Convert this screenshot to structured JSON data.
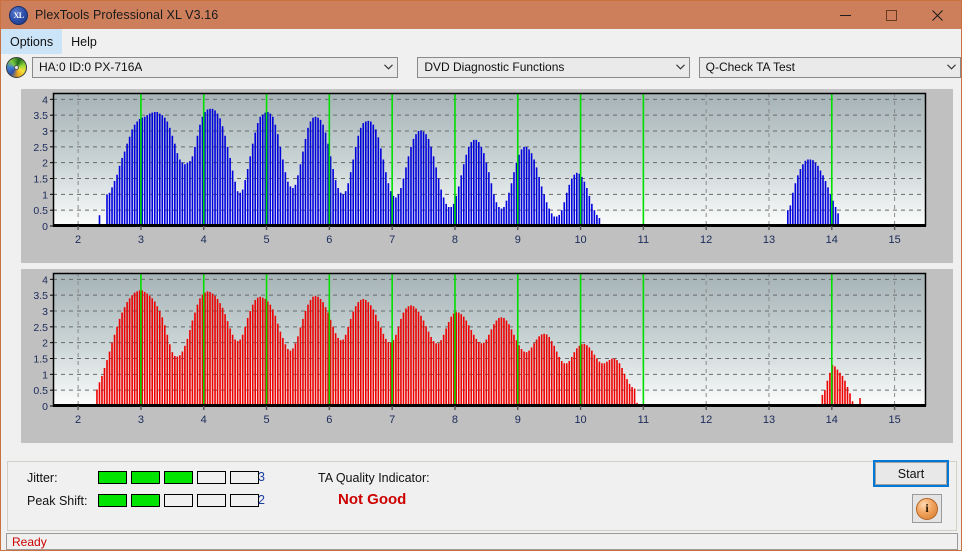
{
  "window": {
    "title": "PlexTools Professional XL V3.16",
    "icon": "app-xl-icon",
    "icon_text": "XL",
    "titlebar_color": "#cd7f5c",
    "controls": {
      "minimize": "minimize-icon",
      "maximize": "maximize-icon",
      "close": "close-icon"
    }
  },
  "menu": {
    "items": [
      {
        "label": "Options",
        "selected": true
      },
      {
        "label": "Help",
        "selected": false
      }
    ]
  },
  "toolbar": {
    "drive_icon": "disc-icon",
    "drive": {
      "value": "HA:0 ID:0  PX-716A",
      "arrow": "chevron-down-icon"
    },
    "category": {
      "value": "DVD Diagnostic Functions",
      "arrow": "chevron-down-icon"
    },
    "test": {
      "value": "Q-Check TA Test",
      "arrow": "chevron-down-icon"
    }
  },
  "results": {
    "jitter_label": "Jitter:",
    "jitter_value": "3",
    "jitter_filled": 3,
    "jitter_total": 5,
    "peakshift_label": "Peak Shift:",
    "peakshift_value": "2",
    "peakshift_filled": 2,
    "peakshift_total": 5,
    "ta_quality_label": "TA Quality Indicator:",
    "ta_quality_value": "Not Good",
    "ta_quality_color": "#cc0000",
    "meter_on_color": "#00e400",
    "start_label": "Start",
    "info_icon": "info-icon",
    "info_glyph": "i"
  },
  "statusbar": {
    "text": "Ready",
    "color": "#cc0000"
  },
  "chart_data": [
    {
      "id": "top-chart",
      "type": "bar",
      "series_name": "Jitter",
      "bar_color": "#0000dd",
      "title": "",
      "xlabel": "",
      "ylabel": "",
      "xlim": [
        1.6,
        15.5
      ],
      "ylim": [
        0,
        4.2
      ],
      "yticks": [
        0,
        0.5,
        1,
        1.5,
        2,
        2.5,
        3,
        3.5,
        4
      ],
      "ytick_labels": [
        "0",
        "0.5",
        "1",
        "1.5",
        "2",
        "2.5",
        "3",
        "3.5",
        "4"
      ],
      "xticks": [
        2,
        3,
        4,
        5,
        6,
        7,
        8,
        9,
        10,
        11,
        12,
        13,
        14,
        15
      ],
      "xtick_labels": [
        "2",
        "3",
        "4",
        "5",
        "6",
        "7",
        "8",
        "9",
        "10",
        "11",
        "12",
        "13",
        "14",
        "15"
      ],
      "grid": true,
      "marker_lines": [
        3,
        4,
        5,
        6,
        7,
        8,
        9,
        10,
        11,
        14
      ],
      "marker_color": "#00e000",
      "bar_step": 0.04,
      "x_start": 2.34,
      "values": [
        0.34,
        0.05,
        0.06,
        1.0,
        1.05,
        1.22,
        1.42,
        1.62,
        1.9,
        2.15,
        2.35,
        2.6,
        2.82,
        3.05,
        3.2,
        3.3,
        3.38,
        3.42,
        3.45,
        3.5,
        3.55,
        3.58,
        3.6,
        3.6,
        3.55,
        3.5,
        3.42,
        3.3,
        3.1,
        2.85,
        2.6,
        2.3,
        2.1,
        2.0,
        1.95,
        2.0,
        2.05,
        2.2,
        2.5,
        2.85,
        3.2,
        3.45,
        3.6,
        3.68,
        3.7,
        3.7,
        3.65,
        3.55,
        3.4,
        3.15,
        2.85,
        2.5,
        2.15,
        1.75,
        1.4,
        1.1,
        1.05,
        1.15,
        1.45,
        1.8,
        2.2,
        2.6,
        2.95,
        3.25,
        3.45,
        3.52,
        3.58,
        3.6,
        3.55,
        3.45,
        3.2,
        2.9,
        2.5,
        2.1,
        1.7,
        1.4,
        1.25,
        1.2,
        1.3,
        1.6,
        1.95,
        2.35,
        2.75,
        3.1,
        3.3,
        3.42,
        3.45,
        3.42,
        3.35,
        3.2,
        2.95,
        2.6,
        2.2,
        1.8,
        1.45,
        1.2,
        1.05,
        1.0,
        1.1,
        1.35,
        1.7,
        2.1,
        2.5,
        2.85,
        3.1,
        3.25,
        3.3,
        3.32,
        3.3,
        3.2,
        3.05,
        2.8,
        2.45,
        2.1,
        1.7,
        1.35,
        1.1,
        0.95,
        0.9,
        1.0,
        1.2,
        1.5,
        1.85,
        2.2,
        2.5,
        2.75,
        2.9,
        3.0,
        3.02,
        2.98,
        2.9,
        2.75,
        2.5,
        2.2,
        1.85,
        1.5,
        1.15,
        0.9,
        0.7,
        0.6,
        0.6,
        0.7,
        0.95,
        1.25,
        1.6,
        1.95,
        2.25,
        2.5,
        2.65,
        2.72,
        2.72,
        2.65,
        2.5,
        2.3,
        2.0,
        1.7,
        1.35,
        1.0,
        0.75,
        0.6,
        0.55,
        0.6,
        0.8,
        1.05,
        1.35,
        1.7,
        2.0,
        2.25,
        2.42,
        2.5,
        2.5,
        2.42,
        2.3,
        2.1,
        1.85,
        1.55,
        1.25,
        1.0,
        0.75,
        0.55,
        0.4,
        0.3,
        0.3,
        0.35,
        0.5,
        0.75,
        1.05,
        1.3,
        1.5,
        1.62,
        1.68,
        1.65,
        1.55,
        1.4,
        1.2,
        0.95,
        0.7,
        0.5,
        0.35,
        0.25
      ],
      "second_group": {
        "x_start": 13.3,
        "values": [
          0.5,
          0.65,
          1.05,
          1.35,
          1.6,
          1.8,
          1.95,
          2.06,
          2.1,
          2.1,
          2.08,
          2.0,
          1.9,
          1.75,
          1.6,
          1.42,
          1.22,
          1.0,
          0.8,
          0.6,
          0.4
        ]
      }
    },
    {
      "id": "bottom-chart",
      "type": "bar",
      "series_name": "Peak Shift",
      "bar_color": "#ee0000",
      "title": "",
      "xlabel": "",
      "ylabel": "",
      "xlim": [
        1.6,
        15.5
      ],
      "ylim": [
        0,
        4.2
      ],
      "yticks": [
        0,
        0.5,
        1,
        1.5,
        2,
        2.5,
        3,
        3.5,
        4
      ],
      "ytick_labels": [
        "0",
        "0.5",
        "1",
        "1.5",
        "2",
        "2.5",
        "3",
        "3.5",
        "4"
      ],
      "xticks": [
        2,
        3,
        4,
        5,
        6,
        7,
        8,
        9,
        10,
        11,
        12,
        13,
        14,
        15
      ],
      "xtick_labels": [
        "2",
        "3",
        "4",
        "5",
        "6",
        "7",
        "8",
        "9",
        "10",
        "11",
        "12",
        "13",
        "14",
        "15"
      ],
      "grid": true,
      "marker_lines": [
        3,
        4,
        5,
        6,
        7,
        8,
        9,
        10,
        11,
        14
      ],
      "marker_color": "#00e000",
      "bar_step": 0.04,
      "x_start": 2.3,
      "values": [
        0.52,
        0.75,
        0.95,
        1.2,
        1.45,
        1.72,
        2.0,
        2.25,
        2.5,
        2.75,
        2.95,
        3.12,
        3.28,
        3.4,
        3.5,
        3.58,
        3.62,
        3.65,
        3.65,
        3.6,
        3.55,
        3.48,
        3.4,
        3.3,
        3.15,
        3.0,
        2.8,
        2.55,
        2.25,
        1.95,
        1.7,
        1.58,
        1.56,
        1.6,
        1.72,
        1.9,
        2.12,
        2.4,
        2.7,
        2.95,
        3.2,
        3.4,
        3.52,
        3.58,
        3.62,
        3.6,
        3.55,
        3.48,
        3.38,
        3.25,
        3.1,
        2.9,
        2.68,
        2.45,
        2.25,
        2.1,
        2.05,
        2.1,
        2.25,
        2.5,
        2.78,
        3.0,
        3.2,
        3.35,
        3.42,
        3.45,
        3.42,
        3.38,
        3.3,
        3.2,
        3.05,
        2.85,
        2.6,
        2.35,
        2.15,
        1.95,
        1.8,
        1.75,
        1.82,
        1.98,
        2.2,
        2.48,
        2.75,
        3.0,
        3.2,
        3.35,
        3.45,
        3.48,
        3.45,
        3.38,
        3.28,
        3.12,
        2.95,
        2.72,
        2.5,
        2.3,
        2.15,
        2.08,
        2.1,
        2.25,
        2.5,
        2.75,
        2.98,
        3.15,
        3.28,
        3.35,
        3.38,
        3.35,
        3.28,
        3.18,
        3.05,
        2.88,
        2.68,
        2.48,
        2.28,
        2.12,
        2.02,
        2.0,
        2.08,
        2.25,
        2.5,
        2.75,
        2.95,
        3.08,
        3.15,
        3.18,
        3.15,
        3.08,
        2.98,
        2.85,
        2.7,
        2.52,
        2.35,
        2.18,
        2.05,
        1.98,
        1.98,
        2.08,
        2.25,
        2.45,
        2.65,
        2.82,
        2.92,
        2.96,
        2.95,
        2.9,
        2.82,
        2.7,
        2.55,
        2.4,
        2.25,
        2.12,
        2.02,
        1.98,
        2.0,
        2.1,
        2.25,
        2.42,
        2.58,
        2.7,
        2.78,
        2.8,
        2.78,
        2.7,
        2.58,
        2.42,
        2.25,
        2.08,
        1.92,
        1.8,
        1.72,
        1.7,
        1.75,
        1.85,
        1.98,
        2.1,
        2.2,
        2.26,
        2.28,
        2.26,
        2.18,
        2.05,
        1.9,
        1.72,
        1.55,
        1.42,
        1.35,
        1.35,
        1.42,
        1.55,
        1.7,
        1.82,
        1.9,
        1.95,
        1.96,
        1.92,
        1.85,
        1.75,
        1.62,
        1.5,
        1.4,
        1.35,
        1.35,
        1.4,
        1.45,
        1.5,
        1.5,
        1.45,
        1.35,
        1.2,
        1.02,
        0.85,
        0.7,
        0.6,
        0.55,
        0.1
      ],
      "second_group": {
        "x_start": 13.85,
        "values": [
          0.35,
          0.5,
          0.8,
          1.05,
          1.3,
          1.25,
          1.15,
          1.05,
          0.95,
          0.8,
          0.6,
          0.4,
          0.15,
          0.0,
          0.0,
          0.25
        ]
      }
    }
  ]
}
